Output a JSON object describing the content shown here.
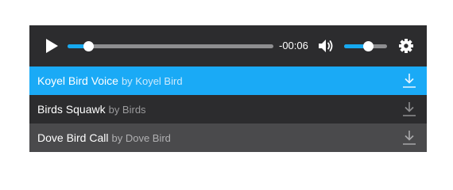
{
  "player": {
    "time_remaining": "-00:06",
    "progress": 0.1,
    "volume": 0.55,
    "accent_color": "#16a9f0",
    "icons": {
      "play": "play-icon",
      "volume": "volume-icon",
      "settings": "gear-icon",
      "download": "download-icon"
    }
  },
  "playlist": [
    {
      "title": "Koyel Bird Voice",
      "by": "by Koyel Bird",
      "active": true
    },
    {
      "title": "Birds Squawk",
      "by": "by Birds",
      "active": false
    },
    {
      "title": "Dove Bird Call",
      "by": "by Dove Bird",
      "active": false
    }
  ]
}
